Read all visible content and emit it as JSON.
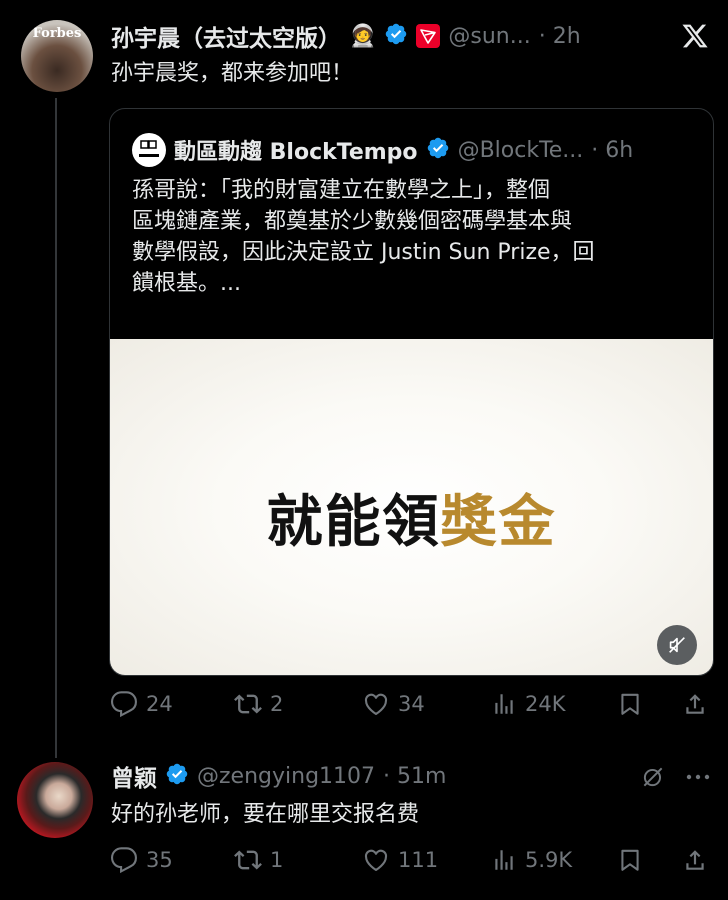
{
  "main_post": {
    "avatar_text": "Forbes",
    "display_name": "孙宇晨（去过太空版）",
    "emoji": "🧑‍🚀",
    "handle": "@sun...",
    "time": "· 2h",
    "text": "孙宇晨奖，都来参加吧！",
    "quote": {
      "avatar_text": "BLOCKTEMPO",
      "display_name": "動區動趨 BlockTempo",
      "handle": "@BlockTe...",
      "time": "· 6h",
      "lines": [
        "孫哥說：「我的財富建立在數學之上」，整個",
        "區塊鏈產業，都奠基於少數幾個密碼學基本與",
        "數學假設，因此決定設立 Justin Sun Prize，回",
        "饋根基。..."
      ],
      "media_text_dark": "就能領",
      "media_text_gold": "獎金"
    },
    "actions": {
      "replies": "24",
      "reposts": "2",
      "likes": "34",
      "views": "24K"
    }
  },
  "reply_post": {
    "display_name": "曾颖",
    "handle": "@zengying1107",
    "time": "· 51m",
    "text": "好的孙老师，要在哪里交报名费",
    "actions": {
      "replies": "35",
      "reposts": "1",
      "likes": "111",
      "views": "5.9K"
    }
  },
  "colors": {
    "accent": "#1d9bf0",
    "tron": "#eb0029",
    "gold": "#b8892e",
    "muted": "#71767b"
  },
  "icons": [
    "verified-icon",
    "tron-icon",
    "x-close-icon",
    "reply-icon",
    "repost-icon",
    "like-icon",
    "views-icon",
    "bookmark-icon",
    "share-icon",
    "mute-icon",
    "grok-icon",
    "more-icon"
  ]
}
